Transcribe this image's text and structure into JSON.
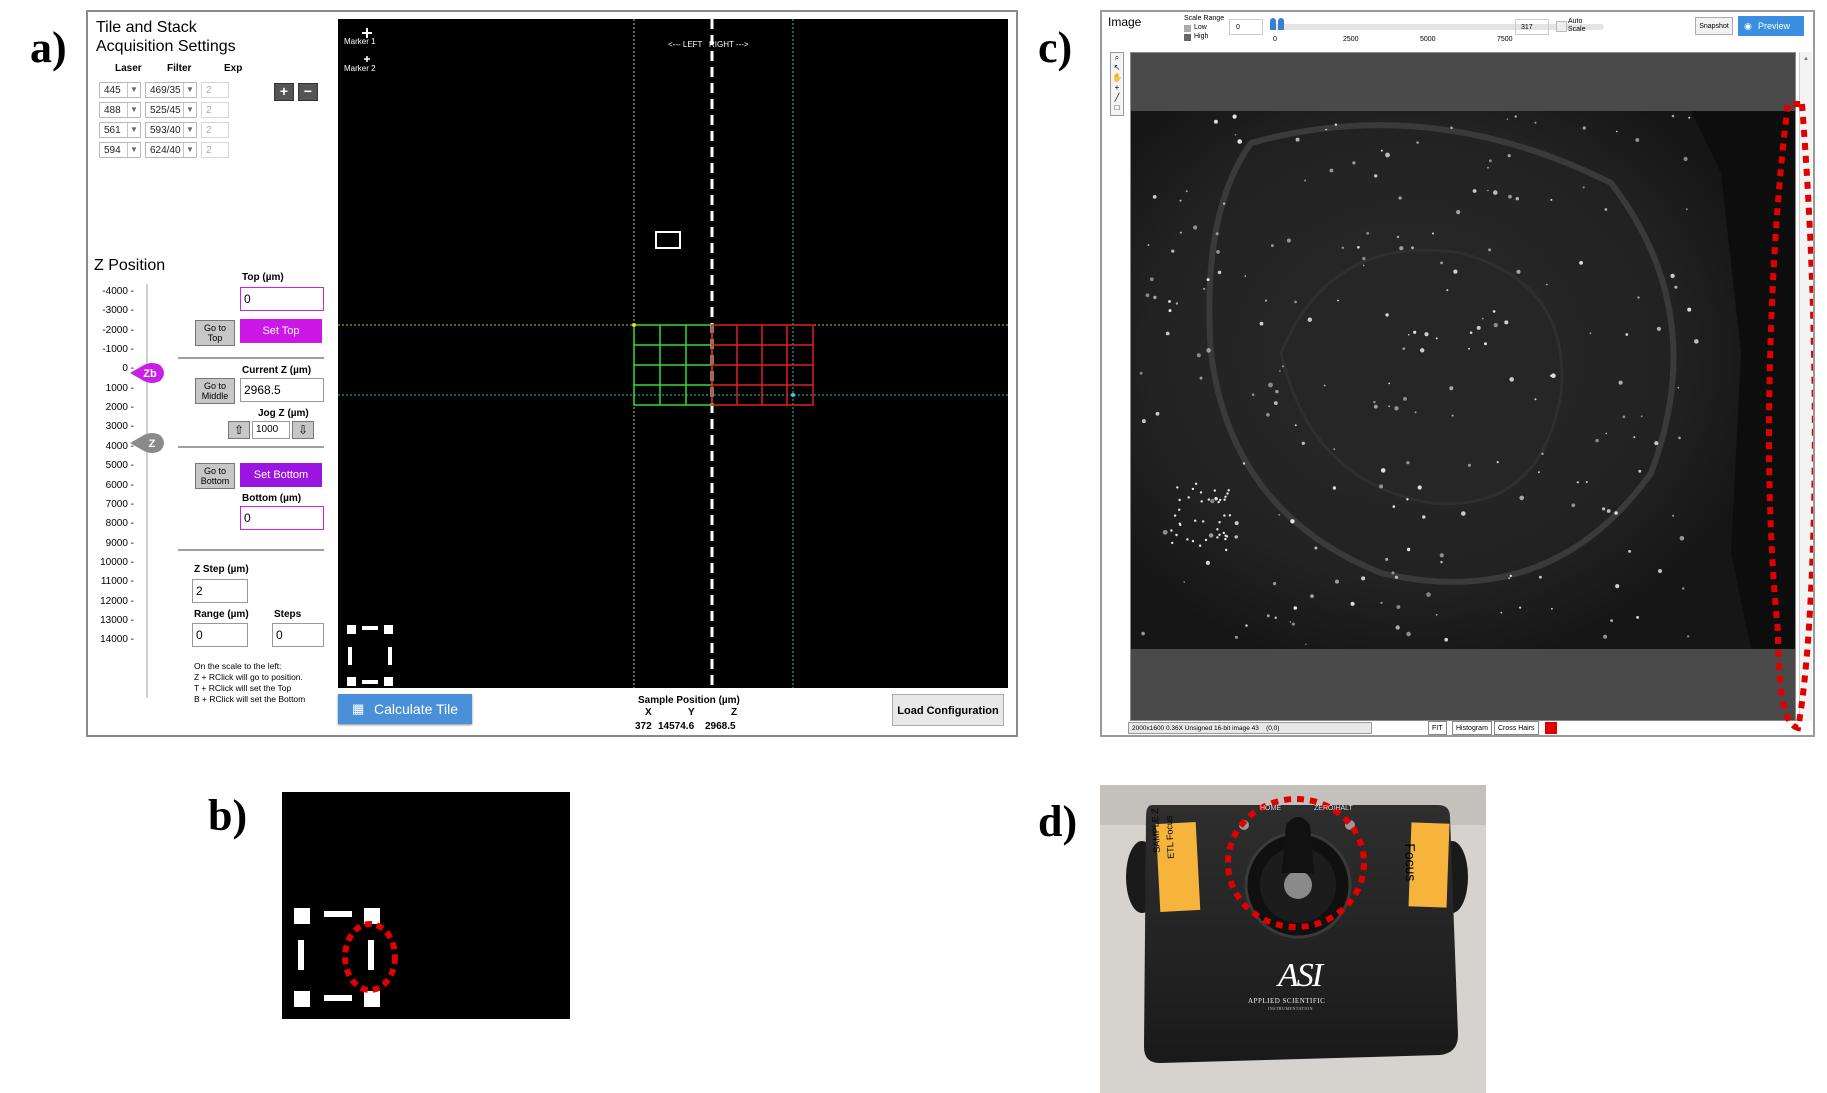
{
  "panel_labels": {
    "a": "a)",
    "b": "b)",
    "c": "c)",
    "d": "d)"
  },
  "panel_a": {
    "title_line1": "Tile and Stack",
    "title_line2": "Acquisition Settings",
    "col_laser": "Laser",
    "col_filter": "Filter",
    "col_exp": "Exp",
    "channels": [
      {
        "laser": "445",
        "filter": "469/35",
        "exp": "2"
      },
      {
        "laser": "488",
        "filter": "525/45",
        "exp": "2"
      },
      {
        "laser": "561",
        "filter": "593/40",
        "exp": "2"
      },
      {
        "laser": "594",
        "filter": "624/40",
        "exp": "2"
      }
    ],
    "add_label": "+",
    "remove_label": "−",
    "z_position_title": "Z Position",
    "z_ticks": [
      "-4000",
      "-3000",
      "-2000",
      "-1000",
      "0",
      "1000",
      "2000",
      "3000",
      "4000",
      "5000",
      "6000",
      "7000",
      "8000",
      "9000",
      "10000",
      "11000",
      "12000",
      "13000",
      "14000"
    ],
    "zb_marker": "Zb",
    "z_marker": "Z",
    "top_label": "Top (µm)",
    "top_value": "0",
    "goto_top": "Go to Top",
    "set_top": "Set Top",
    "current_z_label": "Current Z (µm)",
    "current_z_value": "2968.5",
    "goto_middle": "Go to Middle",
    "jog_label": "Jog Z (µm)",
    "jog_value": "1000",
    "goto_bottom": "Go to Bottom",
    "set_bottom": "Set Bottom",
    "bottom_label": "Bottom (µm)",
    "bottom_value": "0",
    "z_step_label": "Z Step (µm)",
    "z_step_value": "2",
    "range_label": "Range (µm)",
    "range_value": "0",
    "steps_label": "Steps",
    "steps_value": "0",
    "hint_lines": [
      "On the scale to the left:",
      "Z + RClick will go to position.",
      "T + RClick will set the Top",
      "B + RClick will set the Bottom"
    ],
    "marker1": "Marker 1",
    "marker2": "Marker 2",
    "left_right": "<--- LEFT   RIGHT --->",
    "calculate_tile": "Calculate Tile",
    "sample_position_label": "Sample Position (µm)",
    "sp_x_label": "X",
    "sp_y_label": "Y",
    "sp_z_label": "Z",
    "sp_x": "372",
    "sp_y": "14574.6",
    "sp_z": "2968.5",
    "load_configuration": "Load Configuration",
    "colors": {
      "accent_pink": "#cc17e6",
      "accent_purple": "#9a15e0",
      "grid_green": "#33dd33",
      "grid_red": "#e02020",
      "calc_blue": "#4a90d9"
    }
  },
  "panel_c": {
    "title": "Image",
    "scale_range": "Scale Range",
    "low": "Low",
    "high": "High",
    "min_value": "0",
    "max_value": "317",
    "ticks": [
      "0",
      "2500",
      "5000",
      "7500"
    ],
    "auto_scale_line1": "Auto",
    "auto_scale_line2": "Scale",
    "snapshot": "Snapshot",
    "preview": "Preview",
    "status": "2000x1600 0.36X Unsigned 16-bit image 43    (0,0)",
    "fit": "FIT",
    "histogram": "Histogram",
    "cross_hairs": "Cross Hairs"
  },
  "panel_d": {
    "home": "HOME",
    "zero_halt": "ZERO/HALT",
    "left_label_line1": "SAMPLE Z",
    "left_label_line2": "ETL Focus",
    "right_label": "Focus",
    "logo": "ASI",
    "brand_line1": "APPLIED SCIENTIFIC",
    "brand_line2": "INSTRUMENTATION"
  }
}
